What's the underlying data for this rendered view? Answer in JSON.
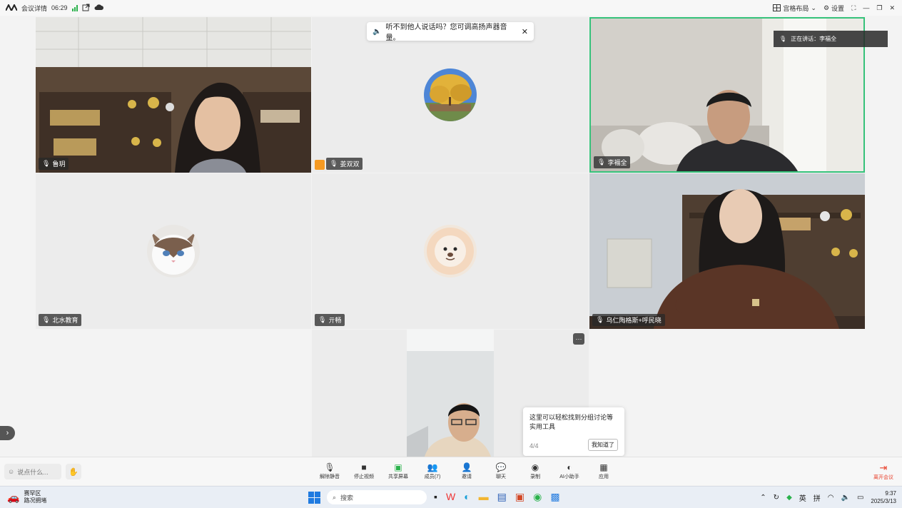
{
  "topbar": {
    "meeting_details": "会议详情",
    "duration": "06:29",
    "layout": "宫格布局",
    "settings": "设置"
  },
  "tooltip": {
    "text": "听不到他人说话吗？您可调高扬声器音量。"
  },
  "speaking": {
    "text": "正在讲话：李福全"
  },
  "participants": [
    {
      "name": "鲁玥"
    },
    {
      "name": "姜双双"
    },
    {
      "name": "李福全"
    },
    {
      "name": "北水教育"
    },
    {
      "name": "亓畅"
    },
    {
      "name": "乌仁陶格斯+呼民晓"
    }
  ],
  "guide": {
    "text": "这里可以轻松找到分组讨论等实用工具",
    "count": "4/4",
    "button": "我知道了"
  },
  "toolbar": {
    "say_placeholder": "说点什么...",
    "tools": [
      {
        "label": "解除静音",
        "icon": "mic-muted-icon"
      },
      {
        "label": "停止视频",
        "icon": "video-icon"
      },
      {
        "label": "共享屏幕",
        "icon": "share-screen-icon"
      },
      {
        "label": "成员(7)",
        "icon": "members-icon"
      },
      {
        "label": "邀请",
        "icon": "invite-icon"
      },
      {
        "label": "聊天",
        "icon": "chat-icon"
      },
      {
        "label": "录制",
        "icon": "record-icon"
      },
      {
        "label": "AI小助手",
        "icon": "ai-assistant-icon"
      },
      {
        "label": "应用",
        "icon": "apps-icon"
      }
    ],
    "leave": "离开会议"
  },
  "taskbar": {
    "weather_title": "赛罕区",
    "weather_sub": "路况拥堵",
    "search": "搜索",
    "ime_lang": "英",
    "ime_mode": "拼",
    "time": "9:37",
    "date": "2025/3/13"
  },
  "colors": {
    "active_speaker_border": "#35c27a",
    "leave": "#e8412c",
    "host_badge": "#f59a23"
  }
}
